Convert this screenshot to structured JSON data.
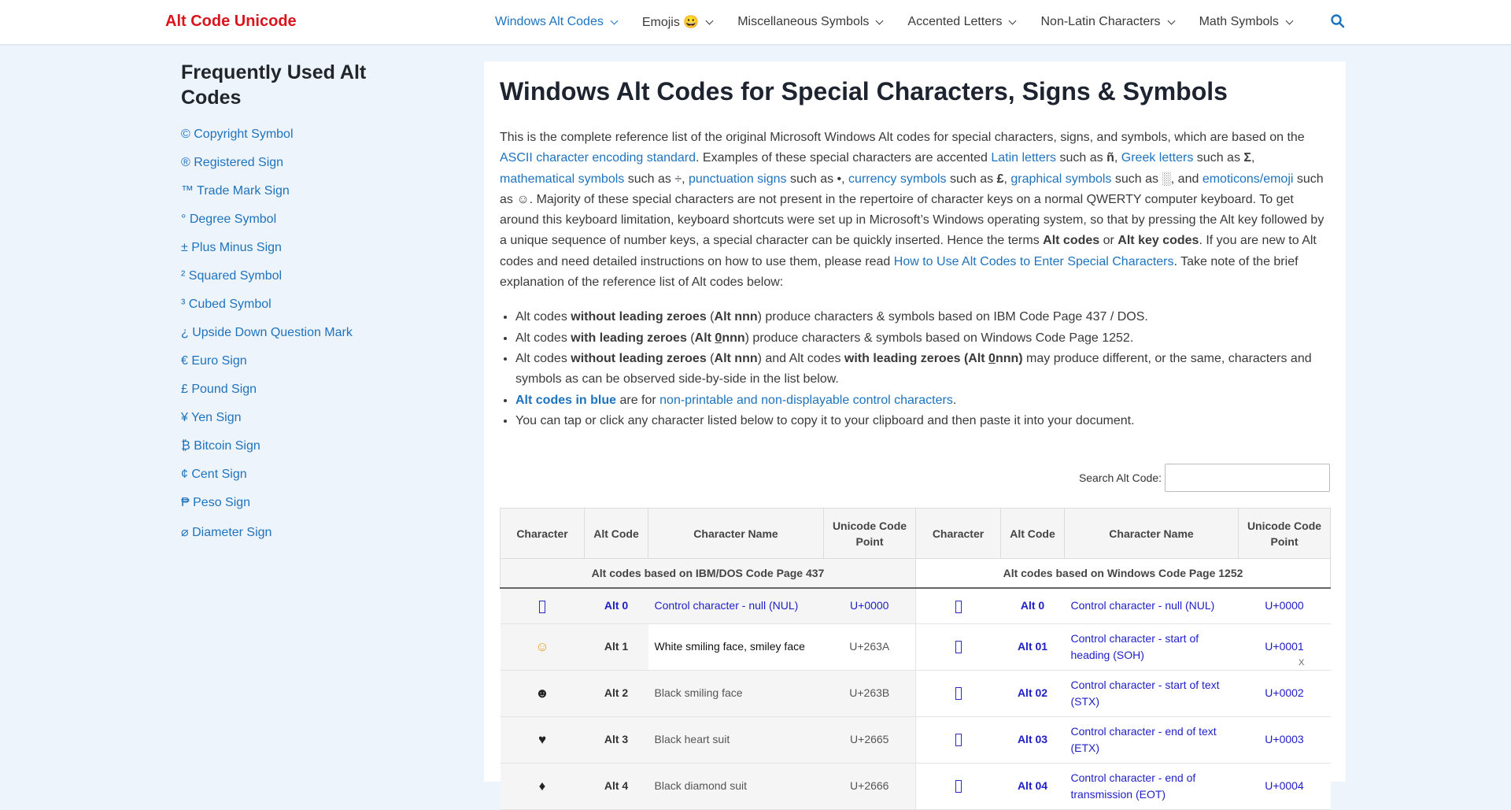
{
  "brand": "Alt Code Unicode",
  "nav": [
    {
      "label": "Windows Alt Codes",
      "active": true
    },
    {
      "label": "Emojis 😀",
      "active": false
    },
    {
      "label": "Miscellaneous Symbols",
      "active": false
    },
    {
      "label": "Accented Letters",
      "active": false
    },
    {
      "label": "Non-Latin Characters",
      "active": false
    },
    {
      "label": "Math Symbols",
      "active": false
    }
  ],
  "sidebar": {
    "title": "Frequently Used Alt Codes",
    "items": [
      "© Copyright Symbol",
      "® Registered Sign",
      "™ Trade Mark Sign",
      "° Degree Symbol",
      "± Plus Minus Sign",
      "² Squared Symbol",
      "³ Cubed Symbol",
      "¿ Upside Down Question Mark",
      "€ Euro Sign",
      "£ Pound Sign",
      "¥ Yen Sign",
      "₿ Bitcoin Sign",
      "¢ Cent Sign",
      "₱ Peso Sign",
      "⌀ Diameter Sign"
    ]
  },
  "main": {
    "title": "Windows Alt Codes for Special Characters, Signs & Symbols",
    "intro": {
      "p1": "This is the complete reference list of the original Microsoft Windows Alt codes for special characters, signs, and symbols, which are based on the ",
      "link_ascii": "ASCII character encoding standard",
      "p2": ". Examples of these special characters are accented ",
      "link_latin": "Latin letters",
      "p3": " such as ",
      "ex_latin": "ñ",
      "p4": ", ",
      "link_greek": "Greek letters",
      "p5": " such as ",
      "ex_greek": "Σ",
      "p6": ", ",
      "link_math": "mathematical symbols",
      "p7": " such as ÷, ",
      "link_punct": "punctuation signs",
      "p8": " such as •, ",
      "link_currency": "currency symbols",
      "p9": " such as ",
      "ex_currency": "£",
      "p10": ", ",
      "link_graphical": "graphical symbols",
      "p11": " such as ░, and ",
      "link_emoji": "emoticons/emoji",
      "p12": " such as ☺. Majority of these special characters are not present in the repertoire of character keys on a normal QWERTY computer keyboard. To get around this keyboard limitation, keyboard shortcuts were set up in Microsoft’s Windows operating system, so that by pressing the Alt key followed by a unique sequence of number keys, a special character can be quickly inserted. Hence the terms ",
      "b_altcodes": "Alt codes",
      "p13": " or ",
      "b_altkey": "Alt key codes",
      "p14": ". If you are new to Alt codes and need detailed instructions on how to use them, please read ",
      "link_howto": "How to Use Alt Codes to Enter Special Characters",
      "p15": ". Take note of the brief explanation of the reference list of Alt codes below:"
    },
    "bullets": {
      "b1_a": "Alt codes ",
      "b1_b": "without leading zeroes",
      "b1_c": " (",
      "b1_d": "Alt nnn",
      "b1_e": ") produce characters & symbols based on IBM Code Page 437 / DOS.",
      "b2_a": "Alt codes ",
      "b2_b": "with leading zeroes",
      "b2_c": " (",
      "b2_d": "Alt ",
      "b2_zero": "0",
      "b2_e": "nnn",
      "b2_f": ") produce characters & symbols based on Windows Code Page 1252.",
      "b3_a": "Alt codes ",
      "b3_b": "without leading zeroes",
      "b3_c": " (",
      "b3_d": "Alt nnn",
      "b3_e": ") and Alt codes ",
      "b3_f": "with leading zeroes (Alt ",
      "b3_zero": "0",
      "b3_g": "nnn)",
      "b3_h": " may produce different, or the same, characters and symbols as can be observed side-by-side in the list below.",
      "b4_a": "Alt codes in blue",
      "b4_b": " are for ",
      "b4_link": "non-printable and non-displayable control characters",
      "b4_c": ".",
      "b5": "You can tap or click any character listed below to copy it to your clipboard and then paste it into your document."
    },
    "search_label": "Search Alt Code:",
    "search_value": "",
    "table": {
      "headers": [
        "Character",
        "Alt Code",
        "Character Name",
        "Unicode Code Point",
        "Character",
        "Alt Code",
        "Character Name",
        "Unicode Code Point"
      ],
      "group_left": "Alt codes based on IBM/DOS Code Page 437",
      "group_right": "Alt codes based on Windows Code Page 1252",
      "rows": [
        {
          "lc": "",
          "la": "Alt 0",
          "ln": "Control character - null (NUL)",
          "lu": "U+0000",
          "l_ctrl": true,
          "rc": "",
          "ra": "Alt 0",
          "rn": "Control character - null (NUL)",
          "ru": "U+0000"
        },
        {
          "lc": "☺",
          "la": "Alt 1",
          "ln": "White smiling face, smiley face",
          "lu": "U+263A",
          "l_ctrl": false,
          "rc": "",
          "ra": "Alt 01",
          "rn": "Control character - start of heading (SOH)",
          "ru": "U+0001"
        },
        {
          "lc": "☻",
          "la": "Alt 2",
          "ln": "Black smiling face",
          "lu": "U+263B",
          "l_ctrl": false,
          "rc": "",
          "ra": "Alt 02",
          "rn": "Control character - start of text (STX)",
          "ru": "U+0002"
        },
        {
          "lc": "♥",
          "la": "Alt 3",
          "ln": "Black heart suit",
          "lu": "U+2665",
          "l_ctrl": false,
          "rc": "",
          "ra": "Alt 03",
          "rn": "Control character - end of text (ETX)",
          "ru": "U+0003"
        },
        {
          "lc": "♦",
          "la": "Alt 4",
          "ln": "Black diamond suit",
          "lu": "U+2666",
          "l_ctrl": false,
          "rc": "",
          "ra": "Alt 04",
          "rn": "Control character - end of transmission (EOT)",
          "ru": "U+0004"
        }
      ]
    },
    "close_label": "X"
  },
  "colors": {
    "brand": "#d9151b",
    "link": "#1e73be",
    "control": "#1e1ec8"
  }
}
